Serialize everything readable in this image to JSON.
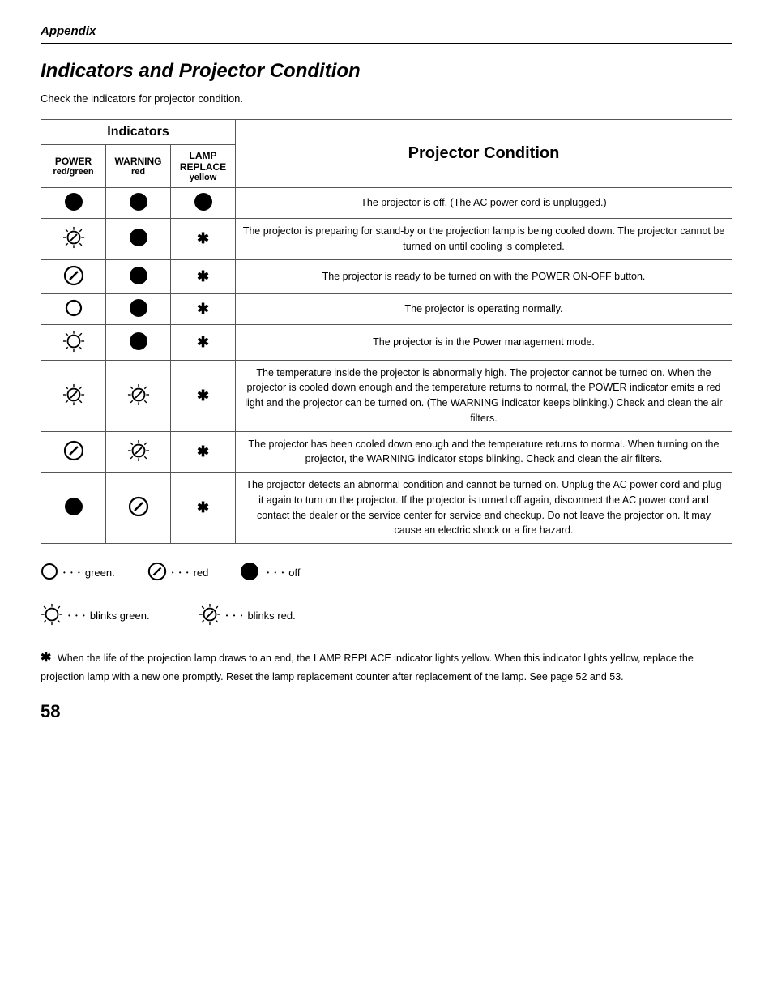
{
  "appendix": {
    "header": "Appendix"
  },
  "section": {
    "title": "Indicators and Projector Condition",
    "intro": "Check the indicators for projector condition."
  },
  "table": {
    "indicators_header": "Indicators",
    "projector_condition_header": "Projector Condition",
    "columns": [
      {
        "label": "POWER",
        "color": "red/green"
      },
      {
        "label": "WARNING",
        "color": "red"
      },
      {
        "label": "LAMP REPLACE",
        "color": "yellow"
      }
    ],
    "rows": [
      {
        "power": "off",
        "warning": "off",
        "lamp": "off",
        "condition": "The projector is off.  (The AC power cord is unplugged.)"
      },
      {
        "power": "blink-red",
        "warning": "off",
        "lamp": "asterisk",
        "condition": "The projector is preparing for stand-by or the projection lamp is being cooled down.  The projector cannot be turned on until cooling is completed."
      },
      {
        "power": "slash",
        "warning": "off",
        "lamp": "asterisk",
        "condition": "The projector is ready to be turned on with the POWER ON-OFF button."
      },
      {
        "power": "open",
        "warning": "off",
        "lamp": "asterisk",
        "condition": "The projector is operating normally."
      },
      {
        "power": "blink-green",
        "warning": "off",
        "lamp": "asterisk",
        "condition": "The projector is in the Power management mode."
      },
      {
        "power": "blink-red",
        "warning": "blink-red",
        "lamp": "asterisk",
        "condition": "The temperature inside the projector is abnormally high.  The projector cannot be turned on.  When  the projector is cooled down enough and the temperature returns to normal, the POWER indicator emits a red light and the projector can be turned on.  (The WARNING indicator keeps blinking.)  Check and clean the air filters."
      },
      {
        "power": "slash",
        "warning": "blink-red",
        "lamp": "asterisk",
        "condition": "The projector has been cooled down enough and the temperature returns to normal.  When turning on the projector, the WARNING indicator stops blinking.  Check and clean the air filters."
      },
      {
        "power": "off",
        "warning": "slash",
        "lamp": "asterisk",
        "condition": "The projector detects an abnormal condition and cannot be turned on.  Unplug the AC power cord and plug it again to turn on the projector.  If the projector is turned off again, disconnect the AC power cord and contact the dealer or the service center for service and checkup.  Do not leave the projector on.  It may cause an electric shock or a fire hazard."
      }
    ]
  },
  "legend": {
    "items": [
      {
        "icon": "open",
        "dots": "• • •",
        "label": "green."
      },
      {
        "icon": "slash",
        "dots": "• • •",
        "label": "red"
      },
      {
        "icon": "off",
        "dots": "• • •",
        "label": "off"
      },
      {
        "icon": "blink-green",
        "dots": "• • •",
        "label": "blinks green."
      },
      {
        "icon": "blink-red",
        "dots": "• • •",
        "label": "blinks red."
      }
    ]
  },
  "footnote": "When the life of the projection lamp draws to an end, the LAMP REPLACE indicator lights yellow. When this indicator lights yellow, replace the projection lamp with a new one promptly.  Reset the lamp replacement counter after replacement of the lamp.  See page 52 and 53.",
  "page_number": "58"
}
